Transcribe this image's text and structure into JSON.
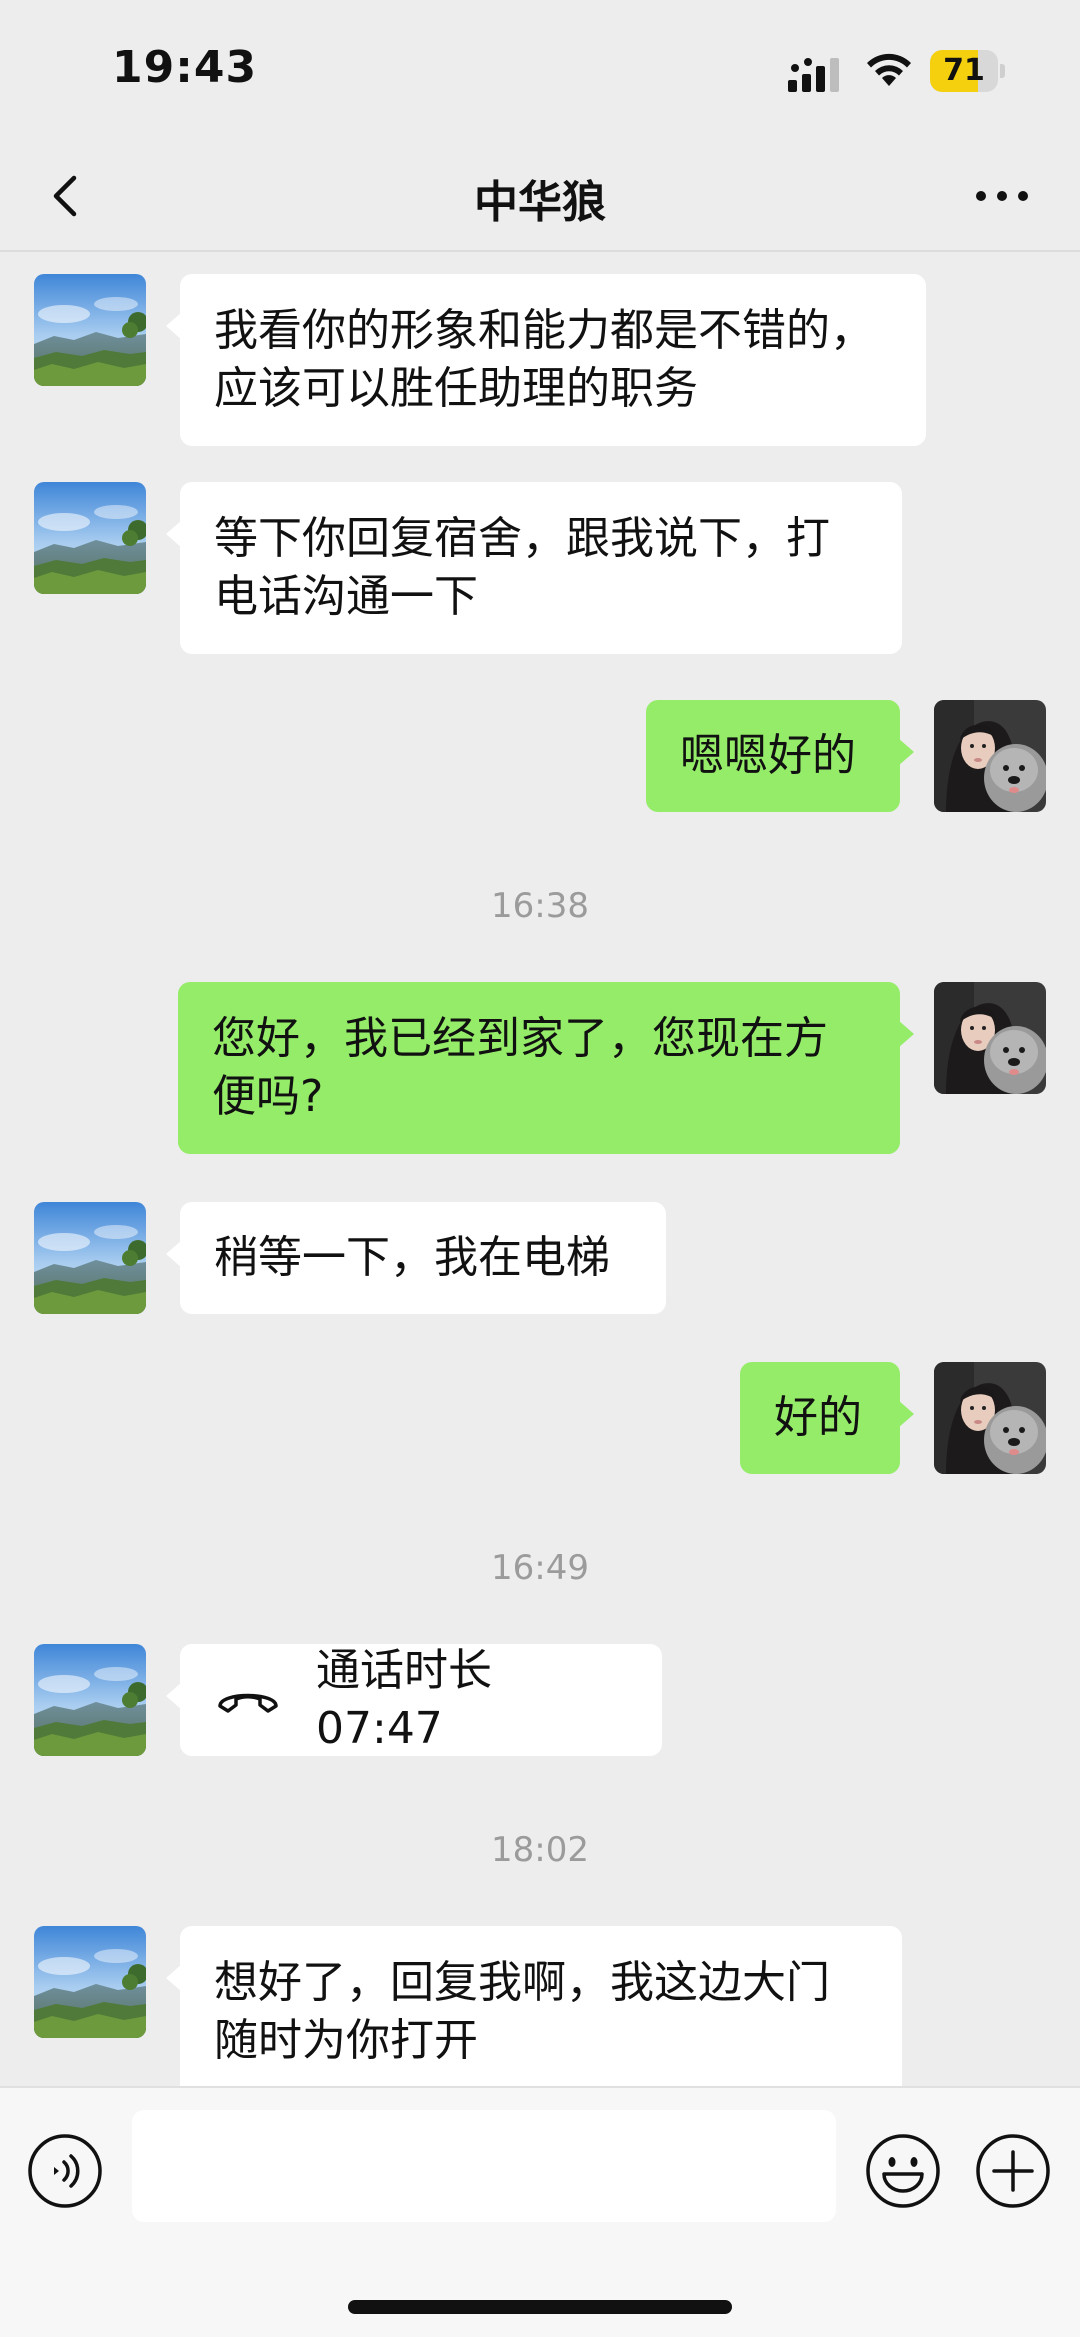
{
  "status_bar": {
    "time": "19:43",
    "battery_level": "71",
    "battery_fraction": 0.71,
    "battery_color": "#f5d00f"
  },
  "nav": {
    "title": "中华狼",
    "back_icon": "chevron-left-icon",
    "more_icon": "more-dots-icon"
  },
  "colors": {
    "sent_bubble": "#95ec69",
    "received_bubble": "#ffffff",
    "background": "#ededed",
    "timestamp": "#9b9b9b"
  },
  "messages": [
    {
      "side": "left",
      "text": "我看你的形象和能力都是不错的，\n应该可以胜任助理的职务"
    },
    {
      "side": "left",
      "text": "等下你回复宿舍，跟我说下，打\n电话沟通一下"
    },
    {
      "side": "right",
      "text": "嗯嗯好的"
    },
    {
      "type": "time",
      "text": "16:38"
    },
    {
      "side": "right",
      "text": "您好，我已经到家了，您现在方\n便吗?"
    },
    {
      "side": "left",
      "text": "稍等一下，我在电梯"
    },
    {
      "side": "right",
      "text": "好的"
    },
    {
      "type": "time",
      "text": "16:49"
    },
    {
      "side": "left",
      "type": "call",
      "icon": "phone-hangup-icon",
      "text": "通话时长 07:47"
    },
    {
      "type": "time",
      "text": "18:02"
    },
    {
      "side": "left",
      "text": "想好了，回复我啊，我这边大门\n随时为你打开"
    }
  ],
  "input_bar": {
    "voice_icon": "voice-icon",
    "input_value": "",
    "emoji_icon": "emoji-icon",
    "plus_icon": "plus-icon"
  }
}
